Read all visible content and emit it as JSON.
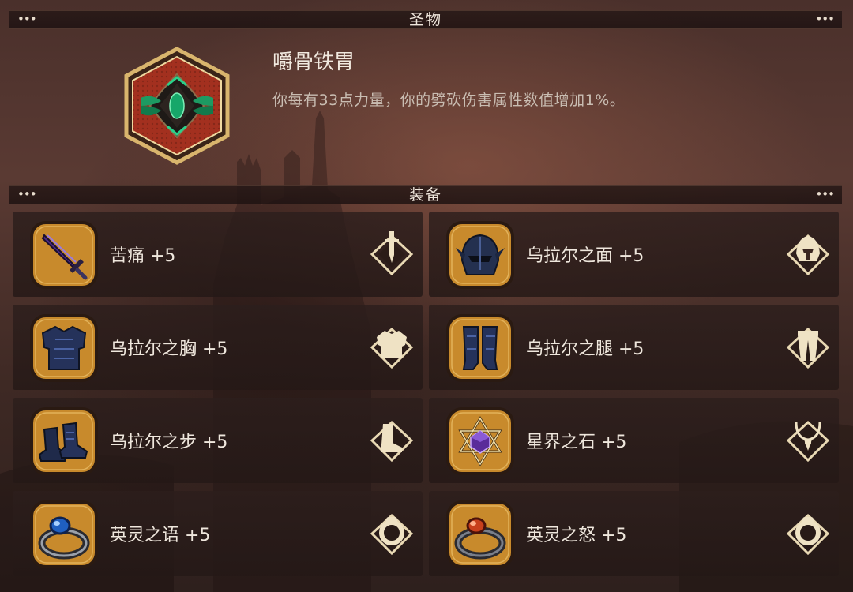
{
  "relic_section": {
    "header": "圣物",
    "dots_left": "•••",
    "dots_right": "•••",
    "name": "嚼骨铁胃",
    "description": "你每有33点力量，你的劈砍伤害属性数值增加1%。",
    "icon": "relic-gem-emblem-icon"
  },
  "equipment_section": {
    "header": "装备",
    "dots_left": "•••",
    "dots_right": "•••",
    "items": [
      {
        "name": "苦痛 +5",
        "icon": "purple-sword-icon",
        "slot_icon": "weapon-slot-icon"
      },
      {
        "name": "乌拉尔之面 +5",
        "icon": "dark-helmet-icon",
        "slot_icon": "helmet-slot-icon"
      },
      {
        "name": "乌拉尔之胸 +5",
        "icon": "dark-chestplate-icon",
        "slot_icon": "chest-slot-icon"
      },
      {
        "name": "乌拉尔之腿 +5",
        "icon": "dark-greaves-icon",
        "slot_icon": "legs-slot-icon"
      },
      {
        "name": "乌拉尔之步 +5",
        "icon": "dark-boots-icon",
        "slot_icon": "boots-slot-icon"
      },
      {
        "name": "星界之石 +5",
        "icon": "astral-star-stone-icon",
        "slot_icon": "amulet-slot-icon"
      },
      {
        "name": "英灵之语 +5",
        "icon": "blue-gem-ring-icon",
        "slot_icon": "ring-slot-icon"
      },
      {
        "name": "英灵之怒 +5",
        "icon": "red-gem-ring-icon",
        "slot_icon": "ring-slot-icon"
      }
    ]
  },
  "colors": {
    "gold_frame": "#d9b56d",
    "orange_tile": "#c88a2c",
    "relic_red": "#a3301f",
    "panel_dark": "#2c1e1c"
  }
}
